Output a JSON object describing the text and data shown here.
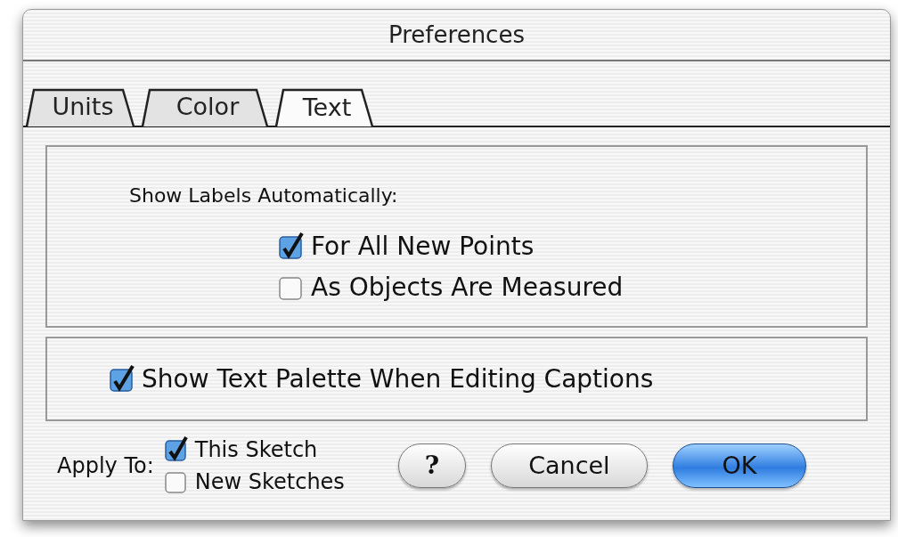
{
  "window": {
    "title": "Preferences"
  },
  "tabs": [
    {
      "label": "Units",
      "selected": false
    },
    {
      "label": "Color",
      "selected": false
    },
    {
      "label": "Text",
      "selected": true
    }
  ],
  "labels_group": {
    "heading": "Show Labels Automatically:",
    "options": [
      {
        "label": "For All New Points",
        "checked": true
      },
      {
        "label": "As Objects Are Measured",
        "checked": false
      }
    ]
  },
  "caption_option": {
    "label": "Show Text Palette When Editing Captions",
    "checked": true
  },
  "apply_to": {
    "label": "Apply To:",
    "options": [
      {
        "label": "This Sketch",
        "checked": true
      },
      {
        "label": "New Sketches",
        "checked": false
      }
    ]
  },
  "buttons": [
    {
      "kind": "help",
      "label": "?"
    },
    {
      "kind": "cancel",
      "label": "Cancel"
    },
    {
      "kind": "default",
      "label": "OK"
    }
  ]
}
